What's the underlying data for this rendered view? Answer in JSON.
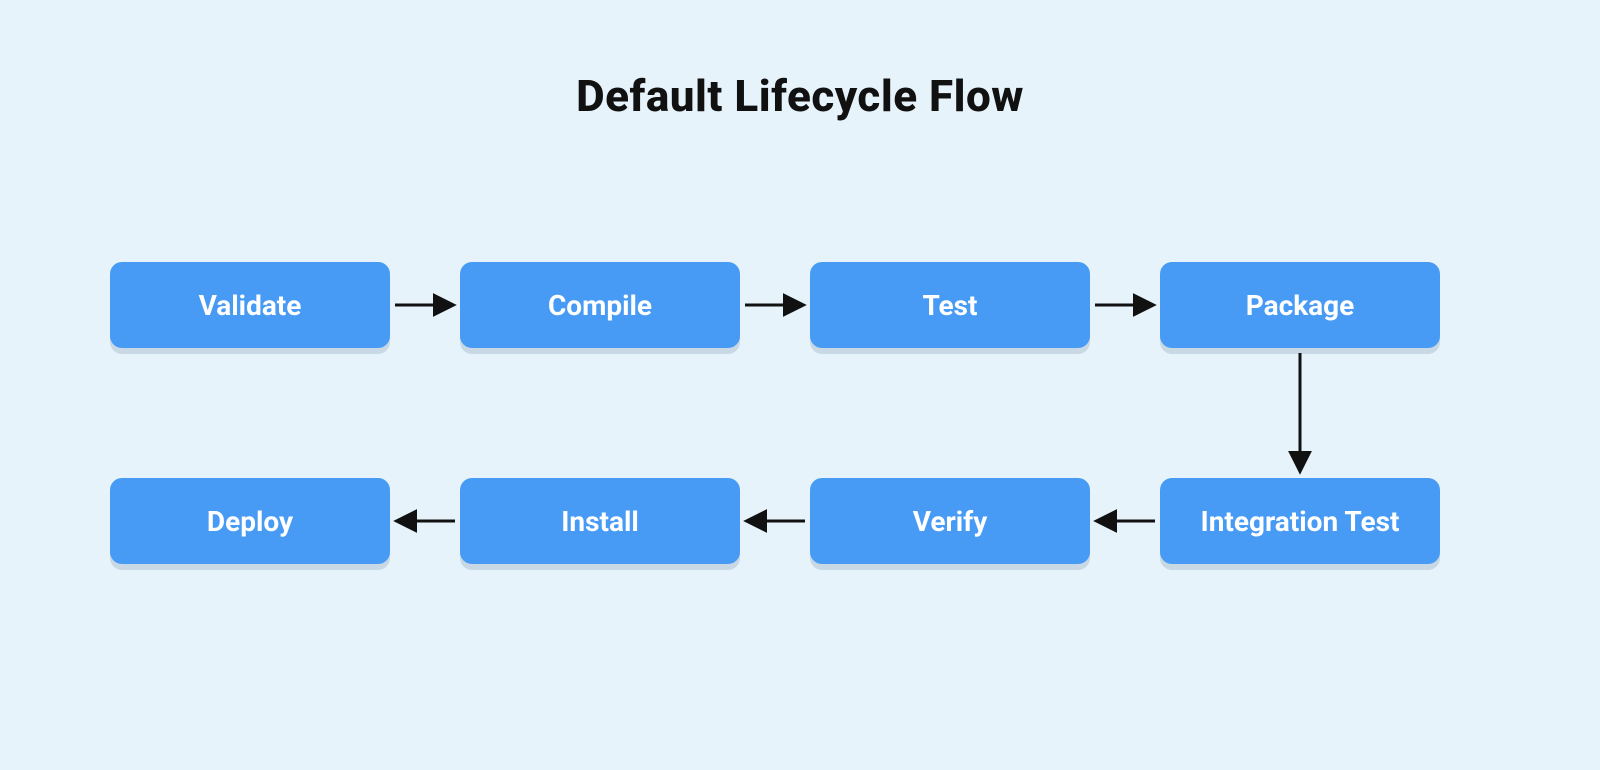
{
  "title": "Default Lifecycle Flow",
  "nodes": {
    "validate": "Validate",
    "compile": "Compile",
    "test": "Test",
    "package": "Package",
    "integration_test": "Integration Test",
    "verify": "Verify",
    "install": "Install",
    "deploy": "Deploy"
  },
  "flow_order": [
    "validate",
    "compile",
    "test",
    "package",
    "integration_test",
    "verify",
    "install",
    "deploy"
  ]
}
